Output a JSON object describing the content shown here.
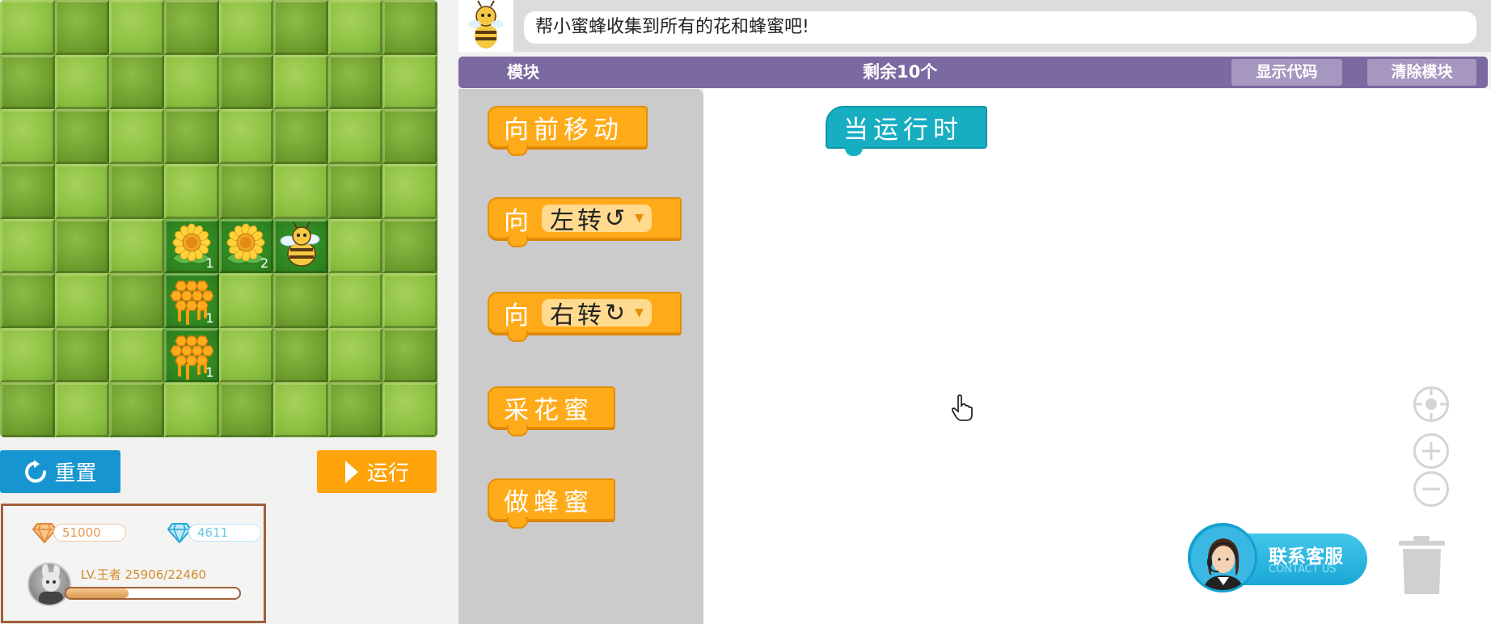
{
  "game": {
    "grid": [
      [
        "light",
        "dark",
        "light",
        "dark",
        "light",
        "dark",
        "light",
        "dark"
      ],
      [
        "dark",
        "light",
        "dark",
        "light",
        "dark",
        "light",
        "dark",
        "light"
      ],
      [
        "light",
        "dark",
        "light",
        "dark",
        "light",
        "dark",
        "light",
        "dark"
      ],
      [
        "dark",
        "light",
        "dark",
        "light",
        "dark",
        "light",
        "dark",
        "light"
      ],
      [
        "light",
        "dark",
        "light",
        "path",
        "path",
        "path",
        "light",
        "dark"
      ],
      [
        "dark",
        "light",
        "dark",
        "path",
        "light",
        "dark",
        "light",
        "light"
      ],
      [
        "light",
        "dark",
        "light",
        "path",
        "light",
        "dark",
        "light",
        "dark"
      ],
      [
        "dark",
        "light",
        "dark",
        "light",
        "dark",
        "light",
        "dark",
        "light"
      ]
    ],
    "items": [
      {
        "row": 4,
        "col": 3,
        "type": "flower",
        "count": "1"
      },
      {
        "row": 4,
        "col": 4,
        "type": "flower",
        "count": "2"
      },
      {
        "row": 4,
        "col": 5,
        "type": "bee",
        "count": ""
      },
      {
        "row": 5,
        "col": 3,
        "type": "honeycomb",
        "count": "1"
      },
      {
        "row": 6,
        "col": 3,
        "type": "honeycomb",
        "count": "1"
      }
    ]
  },
  "controls": {
    "reset_label": "重置",
    "run_label": "运行"
  },
  "user": {
    "gold": "51000",
    "diamond": "4611",
    "level_text": "LV.王者 25906/22460",
    "xp_progress": 0.36
  },
  "task": {
    "prompt": "帮小蜜蜂收集到所有的花和蜂蜜吧!"
  },
  "header": {
    "blocks_label": "模块",
    "remaining_label": "剩余10个",
    "show_code_label": "显示代码",
    "clear_label": "清除模块"
  },
  "palette": {
    "move_forward": "向前移动",
    "turn_prefix": "向",
    "turn_left": "左转",
    "turn_left_glyph": "↺",
    "turn_right": "右转",
    "turn_right_glyph": "↻",
    "collect_nectar": "采花蜜",
    "make_honey": "做蜂蜜"
  },
  "workspace": {
    "hat_block": "当运行时"
  },
  "support": {
    "cn": "联系客服",
    "en": "CONTACT US"
  },
  "colors": {
    "accent_purple": "#7b69a1",
    "block_orange": "#ffab19",
    "hat_teal": "#17aec2",
    "reset_blue": "#1795d0",
    "run_orange": "#ffa30a"
  }
}
